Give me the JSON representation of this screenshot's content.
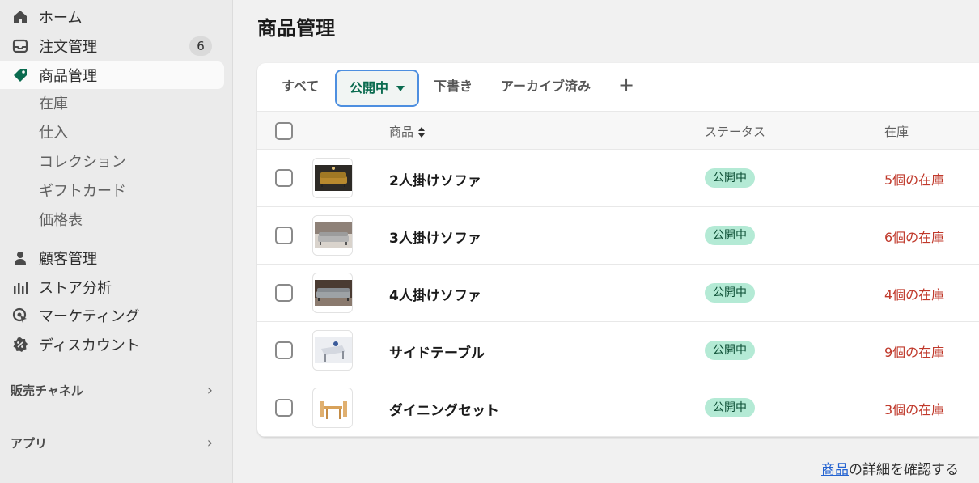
{
  "sidebar": {
    "items": [
      {
        "label": "ホーム",
        "icon": "home-icon"
      },
      {
        "label": "注文管理",
        "icon": "inbox-icon",
        "badge": "6"
      },
      {
        "label": "商品管理",
        "icon": "tag-icon",
        "active": true
      },
      {
        "label": "顧客管理",
        "icon": "person-icon"
      },
      {
        "label": "ストア分析",
        "icon": "bar-chart-icon"
      },
      {
        "label": "マーケティング",
        "icon": "target-icon"
      },
      {
        "label": "ディスカウント",
        "icon": "discount-icon"
      }
    ],
    "sub_items": [
      "在庫",
      "仕入",
      "コレクション",
      "ギフトカード",
      "価格表"
    ],
    "sections": [
      {
        "label": "販売チャネル"
      },
      {
        "label": "アプリ"
      }
    ]
  },
  "page": {
    "title": "商品管理"
  },
  "tabs": {
    "all": "すべて",
    "active": "公開中",
    "draft": "下書き",
    "archived": "アーカイブ済み",
    "add": "+"
  },
  "table": {
    "headers": {
      "product": "商品",
      "status": "ステータス",
      "inventory": "在庫"
    },
    "rows": [
      {
        "name": "2人掛けソファ",
        "status": "公開中",
        "stock": "5個の在庫"
      },
      {
        "name": "3人掛けソファ",
        "status": "公開中",
        "stock": "6個の在庫"
      },
      {
        "name": "4人掛けソファ",
        "status": "公開中",
        "stock": "4個の在庫"
      },
      {
        "name": "サイドテーブル",
        "status": "公開中",
        "stock": "9個の在庫"
      },
      {
        "name": "ダイニングセット",
        "status": "公開中",
        "stock": "3個の在庫"
      }
    ]
  },
  "footer": {
    "link": "商品",
    "text": "の詳細を確認する"
  },
  "colors": {
    "accent": "#0a6b4f",
    "status_bg": "#b4ead5",
    "stock_red": "#c0392b",
    "link": "#2463d1",
    "focus": "#4d8fe0"
  }
}
